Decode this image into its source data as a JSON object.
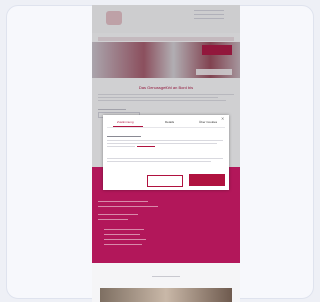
{
  "page": {
    "title": "Das Genussgefühl an Bord bis",
    "logo_text": "",
    "accent": "#b0123f",
    "magenta": "#b2175a"
  },
  "cookie_dialog": {
    "tabs": [
      "Zustimmung",
      "Details",
      "Über Cookies"
    ],
    "active_tab": "Zustimmung",
    "close_icon": "close-icon",
    "button_deny": "",
    "button_accept": ""
  }
}
